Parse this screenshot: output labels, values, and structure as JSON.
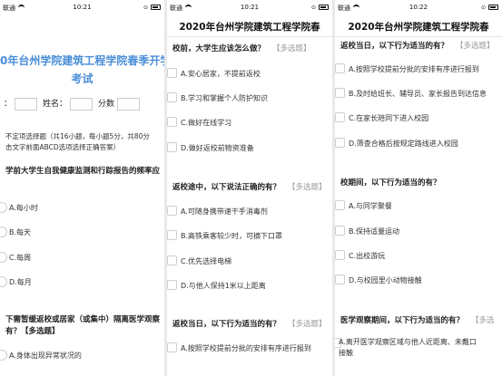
{
  "statusbar": {
    "p1": {
      "carrier": "联通",
      "time": "10:21"
    },
    "p2": {
      "carrier": "联通",
      "time": "10:21"
    },
    "p3": {
      "carrier": "联通",
      "time": "10:22"
    }
  },
  "nav_title": "2020年台州学院建筑工程学院春",
  "exam": {
    "title_line1": "0年台州学院建筑工程学院春季开学",
    "title_line2": "考试",
    "name_prefix": "：",
    "name_label": "姓名：",
    "score_label": "分数",
    "intro_line1": "不定项选择题（共16小题，每小题5分，共80分",
    "intro_line2": "击文字前面ABCD选项选择正确答案）"
  },
  "panel1": {
    "q1": "学前大学生自我健康监测和行踪报告的频率应",
    "q1_options": [
      "A.每小时",
      "B.每天",
      "C.每周",
      "D.每月"
    ],
    "q2_line1": "下需暂缓返校或居家（或集中）隔离医学观察",
    "q2_line2": "有？【多选题】",
    "q2_options": [
      "A.身体出现异常状况的"
    ]
  },
  "panel2": {
    "q1": "校前，大学生应该怎么做？",
    "q1_tag": "【多选题】",
    "q1_options": [
      "A.安心居家，不提前返校",
      "B.学习和掌握个人防护知识",
      "C.做好在线学习",
      "D.做好返校前物资准备"
    ],
    "q2": "返校途中，以下说法正确的有？",
    "q2_tag": "【多选题】",
    "q2_options": [
      "A.可随身携带速干手消毒剂",
      "B.高铁乘客较少时，可摘下口罩",
      "C.优先选择电梯",
      "D.与他人保持1米以上距离"
    ],
    "q3": "返校当日，以下行为适当的有？",
    "q3_tag": "【多选题】",
    "q3_options": [
      "A.按照学校提前分批的安排有序进行报到"
    ]
  },
  "panel3": {
    "q1": "返校当日，以下行为适当的有？",
    "q1_tag": "【多选题】",
    "q1_options": [
      "A.按照学校提前分批的安排有序进行报到",
      "B.及时给班长、辅导员、家长报告到达信息",
      "C.在家长陪同下进入校园",
      "D.筛查合格后按规定路线进入校园"
    ],
    "q2": "校期间，以下行为适当的有？",
    "q2_options": [
      "A.与同学聚餐",
      "B.保持适量运动",
      "C.出校游玩",
      "D.与校园里小动物接触"
    ],
    "q3": "医学观察期间，以下行为适当的有？",
    "q3_tag": "【多选",
    "q3_opt_line1": "A.离开医学观察区域与他人近距离、未戴口",
    "q3_opt_line2": "接触"
  }
}
